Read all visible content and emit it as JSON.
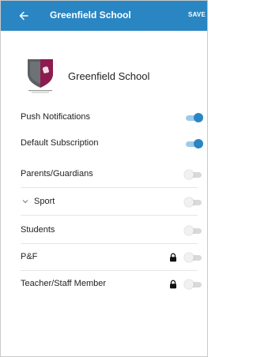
{
  "appbar": {
    "back_icon": "arrow-left-icon",
    "title": "Greenfield School",
    "save_label": "SAVE"
  },
  "school": {
    "name": "Greenfield School",
    "crest_icon": "school-crest-icon",
    "crest_caption": "GREENFIELD SCHOOL"
  },
  "settings": [
    {
      "label": "Push Notifications",
      "on": true
    },
    {
      "label": "Default Subscription",
      "on": true
    }
  ],
  "groups": [
    {
      "label": "Parents/Guardians",
      "on": false,
      "locked": false,
      "expandable": false
    },
    {
      "label": "Sport",
      "on": false,
      "locked": false,
      "expandable": true
    },
    {
      "label": "Students",
      "on": false,
      "locked": false,
      "expandable": false
    },
    {
      "label": "P&F",
      "on": false,
      "locked": true,
      "expandable": false
    },
    {
      "label": "Teacher/Staff Member",
      "on": false,
      "locked": true,
      "expandable": false
    }
  ],
  "colors": {
    "primary": "#2a86c2",
    "toggle_on_track": "#9ccbe8",
    "toggle_off_track": "#d9d9d9",
    "crest_magenta": "#8e1b4f",
    "crest_grey": "#5a5f63"
  }
}
